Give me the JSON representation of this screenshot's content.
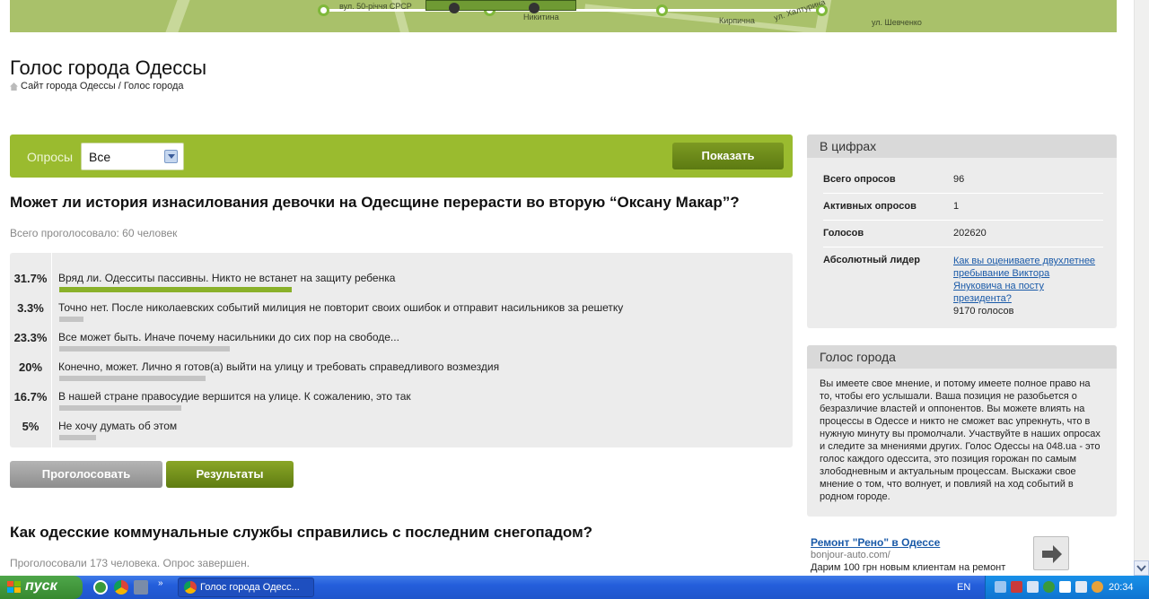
{
  "map": {
    "streets": [
      "вул. 50-річчя СРСР",
      "Никитина",
      "Кирпична",
      "ул. Халтурина",
      "ул. Шевченко"
    ]
  },
  "header": {
    "title": "Голос города Одессы",
    "breadcrumb": "Сайт города Одессы / Голос города"
  },
  "filter": {
    "label": "Опросы",
    "selected": "Все",
    "show_button": "Показать"
  },
  "poll": {
    "question": "Может ли история изнасилования девочки на Одесщине перерасти во вторую “Оксану Макар”?",
    "total_votes": "Всего проголосовало: 60 человек",
    "options": [
      {
        "pct": "31.7%",
        "value": 31.7,
        "label": "Вряд ли. Одесситы пассивны. Никто не встанет на защиту ребенка"
      },
      {
        "pct": "3.3%",
        "value": 3.3,
        "label": "Точно нет. После николаевских событий милиция не повторит своих ошибок и отправит насильников за решетку"
      },
      {
        "pct": "23.3%",
        "value": 23.3,
        "label": "Все может быть. Иначе почему насильники до сих пор на свободе..."
      },
      {
        "pct": "20%",
        "value": 20,
        "label": "Конечно, может. Лично я готов(а) выйти на улицу и требовать справедливого возмездия"
      },
      {
        "pct": "16.7%",
        "value": 16.7,
        "label": "В нашей стране правосудие вершится на улице. К сожалению, это так"
      },
      {
        "pct": "5%",
        "value": 5,
        "label": "Не хочу думать об этом"
      }
    ],
    "vote_button": "Проголосовать",
    "results_button": "Результаты"
  },
  "poll2": {
    "question": "Как одесские коммунальные службы справились с последним снегопадом?",
    "status": "Проголосовали 173 человека. Опрос завершен."
  },
  "stats": {
    "title": "В цифрах",
    "rows": [
      {
        "key": "Всего опросов",
        "value": "96"
      },
      {
        "key": "Активных опросов",
        "value": "1"
      },
      {
        "key": "Голосов",
        "value": "202620"
      }
    ],
    "leader_key": "Абсолютный лидер",
    "leader_link": "Как вы оцениваете двухлетнее пребывание Виктора Януковича на посту президента?",
    "leader_votes": "9170 голосов"
  },
  "about": {
    "title": "Голос города",
    "text": "Вы имеете свое мнение, и потому имеете полное право на то, чтобы его услышали. Ваша позиция не разобьется о безразличие властей и оппонентов. Вы можете влиять на процессы в Одессе и никто не сможет вас упрекнуть, что в нужную минуту вы промолчали. Участвуйте в наших опросах и следите за мнениями других. Голос Одессы на 048.ua - это голос каждого одессита, это позиция горожан по самым злободневным и актуальным процессам. Выскажи свое мнение о том, что волнует, и повлияй на ход событий в родном городе."
  },
  "ad": {
    "title": "Ремонт \"Рено\" в Одессе",
    "url": "bonjour-auto.com/",
    "text": "Дарим 100 грн новым клиентам на ремонт"
  },
  "taskbar": {
    "start": "пуск",
    "window": "Голос города Одесс...",
    "lang": "EN",
    "clock": "20:34"
  },
  "colors": {
    "accent": "#9abb2f",
    "link": "#1a5aa8",
    "bar_lead": "#8ab12a",
    "bar": "#c4c4c4"
  }
}
